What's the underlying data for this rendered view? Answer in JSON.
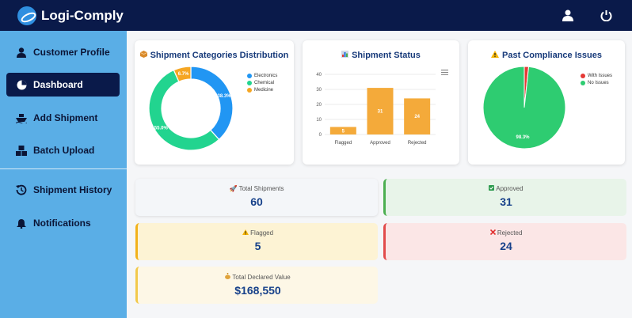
{
  "app": {
    "title": "Logi-Comply"
  },
  "sidebar": {
    "items": [
      {
        "label": "Customer Profile",
        "icon": "user-icon"
      },
      {
        "label": "Dashboard",
        "icon": "pie-icon"
      },
      {
        "label": "Add Shipment",
        "icon": "ship-icon"
      },
      {
        "label": "Batch Upload",
        "icon": "boxes-icon"
      },
      {
        "label": "Shipment History",
        "icon": "history-icon"
      },
      {
        "label": "Notifications",
        "icon": "bell-icon"
      }
    ]
  },
  "cards": {
    "categories_title": "Shipment Categories Distribution",
    "status_title": "Shipment Status",
    "compliance_title": "Past Compliance Issues"
  },
  "stats": {
    "total_label": "Total Shipments",
    "total_value": "60",
    "approved_label": "Approved",
    "approved_value": "31",
    "flagged_label": "Flagged",
    "flagged_value": "5",
    "rejected_label": "Rejected",
    "rejected_value": "24",
    "declared_label": "Total Declared Value",
    "declared_value": "$168,550"
  },
  "colors": {
    "electronics": "#2196f3",
    "chemical": "#22d48f",
    "medicine": "#f5a623",
    "bar": "#f4aa3a",
    "with_issues": "#e53935",
    "no_issues": "#2ecc71"
  },
  "chart_data": [
    {
      "type": "pie",
      "variant": "doughnut",
      "categories": [
        "Electronics",
        "Chemical",
        "Medicine"
      ],
      "values": [
        38.3,
        55.0,
        6.7
      ],
      "labels": [
        "38.3%",
        "55.0%",
        "6.7%"
      ]
    },
    {
      "type": "bar",
      "categories": [
        "Flagged",
        "Approved",
        "Rejected"
      ],
      "values": [
        5,
        31,
        24
      ],
      "ylim": [
        0,
        40
      ],
      "yticks": [
        "0",
        "10",
        "20",
        "30",
        "40"
      ]
    },
    {
      "type": "pie",
      "categories": [
        "With Issues",
        "No Issues"
      ],
      "values": [
        1.7,
        98.3
      ],
      "labels": [
        "98.3%"
      ]
    }
  ]
}
